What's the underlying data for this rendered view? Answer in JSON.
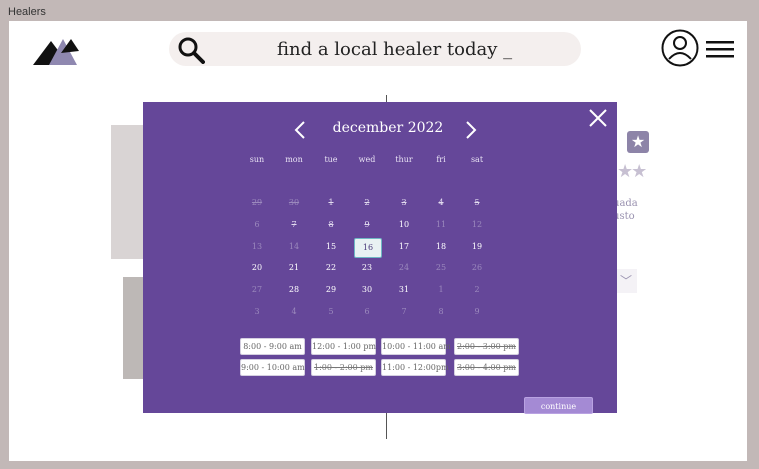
{
  "window": {
    "title": "Healers"
  },
  "header": {
    "search_placeholder": "find a local healer today _"
  },
  "colors": {
    "modal_bg": "#654799",
    "accent": "#a48ad4",
    "page_bg": "#c2b8b7"
  },
  "calendar": {
    "month": "december 2022",
    "weekdays": [
      "sun",
      "mon",
      "tue",
      "wed",
      "thur",
      "fri",
      "sat"
    ],
    "weeks": [
      [
        {
          "d": "29",
          "s": "faded-struck"
        },
        {
          "d": "30",
          "s": "faded-struck"
        },
        {
          "d": "1",
          "s": "struck"
        },
        {
          "d": "2",
          "s": "struck"
        },
        {
          "d": "3",
          "s": "struck"
        },
        {
          "d": "4",
          "s": "struck"
        },
        {
          "d": "5",
          "s": "struck"
        }
      ],
      [
        {
          "d": "6",
          "s": "faded"
        },
        {
          "d": "7",
          "s": "struck"
        },
        {
          "d": "8",
          "s": "struck"
        },
        {
          "d": "9",
          "s": "struck"
        },
        {
          "d": "10",
          "s": "active"
        },
        {
          "d": "11",
          "s": "faded"
        },
        {
          "d": "12",
          "s": "faded"
        }
      ],
      [
        {
          "d": "13",
          "s": "faded"
        },
        {
          "d": "14",
          "s": "faded"
        },
        {
          "d": "15",
          "s": "active"
        },
        {
          "d": "16",
          "s": "selected"
        },
        {
          "d": "17",
          "s": "active"
        },
        {
          "d": "18",
          "s": "active"
        },
        {
          "d": "19",
          "s": "active"
        }
      ],
      [
        {
          "d": "20",
          "s": "active"
        },
        {
          "d": "21",
          "s": "active"
        },
        {
          "d": "22",
          "s": "active"
        },
        {
          "d": "23",
          "s": "active"
        },
        {
          "d": "24",
          "s": "faded"
        },
        {
          "d": "25",
          "s": "faded"
        },
        {
          "d": "26",
          "s": "faded"
        }
      ],
      [
        {
          "d": "27",
          "s": "faded"
        },
        {
          "d": "28",
          "s": "active"
        },
        {
          "d": "29",
          "s": "active"
        },
        {
          "d": "30",
          "s": "active"
        },
        {
          "d": "31",
          "s": "active"
        },
        {
          "d": "1",
          "s": "faded"
        },
        {
          "d": "2",
          "s": "faded"
        }
      ],
      [
        {
          "d": "3",
          "s": "faded"
        },
        {
          "d": "4",
          "s": "faded"
        },
        {
          "d": "5",
          "s": "faded"
        },
        {
          "d": "6",
          "s": "faded"
        },
        {
          "d": "7",
          "s": "faded"
        },
        {
          "d": "8",
          "s": "faded"
        },
        {
          "d": "9",
          "s": "faded"
        }
      ]
    ]
  },
  "time_slots": [
    {
      "label": "8:00 - 9:00 am",
      "available": true
    },
    {
      "label": "12:00 - 1:00 pm",
      "available": true
    },
    {
      "label": "10:00 - 11:00 am",
      "available": true
    },
    {
      "label": "2:00 - 3:00 pm",
      "available": false
    },
    {
      "label": "9:00 - 10:00 am",
      "available": true
    },
    {
      "label": "1:00 - 2:00 pm",
      "available": false
    },
    {
      "label": "11:00 - 12:00pm",
      "available": true
    },
    {
      "label": "3:00 - 4:00 pm",
      "available": false
    }
  ],
  "actions": {
    "continue_label": "continue"
  },
  "background": {
    "snippet_line1": "uada",
    "snippet_line2": "usto"
  },
  "icons": [
    "logo-icon",
    "search-icon",
    "profile-icon",
    "menu-icon",
    "close-icon",
    "chevron-left-icon",
    "chevron-right-icon",
    "star-icon",
    "chevron-down-icon"
  ]
}
